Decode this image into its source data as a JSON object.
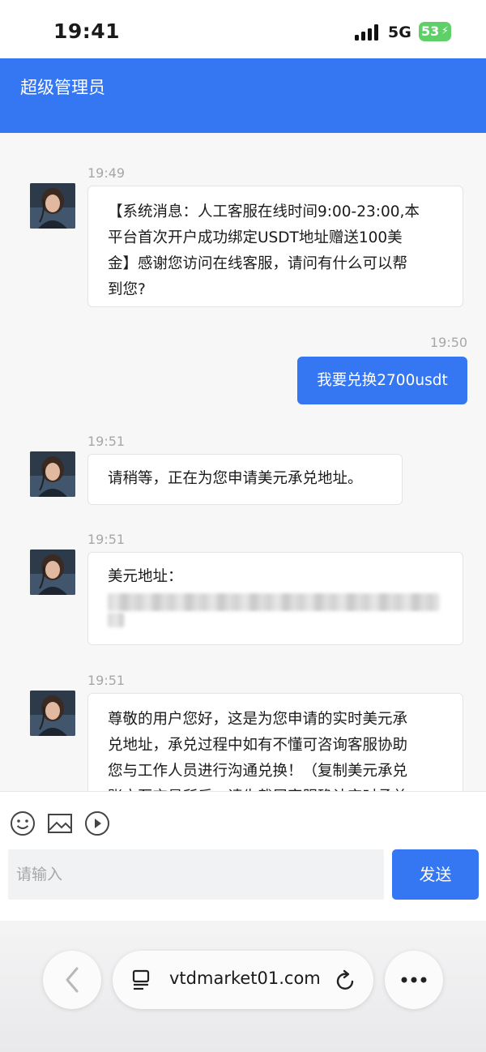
{
  "status_bar": {
    "time": "19:41",
    "network": "5G",
    "battery": "53"
  },
  "header": {
    "title": "超级管理员"
  },
  "messages": [
    {
      "time": "19:49",
      "text_lines": [
        "【系统消息：人工客服在线时间9:00-23:00,本",
        "平台首次开户成功绑定USDT地址赠送100美",
        "金】感谢您访问在线客服，请问有什么可以帮",
        "到您?"
      ]
    },
    {
      "time": "19:50",
      "text": "我要兑换2700usdt"
    },
    {
      "time": "19:51",
      "text": "请稍等，正在为您申请美元承兑地址。"
    },
    {
      "time": "19:51",
      "text": "美元地址："
    },
    {
      "time": "19:51",
      "text_lines": [
        "尊敬的用户您好，这是为您申请的实时美元承",
        "兑地址，承兑过程中如有不懂可咨询客服协助",
        "您与工作人员进行沟通兑换！（复制美元承兑",
        "账户至交易所后，请先截屏客服确认实时承兑"
      ]
    }
  ],
  "input": {
    "placeholder": "请输入",
    "send_label": "发送"
  },
  "toolbar": {
    "icons": [
      "emoji-icon",
      "image-icon",
      "play-icon"
    ]
  },
  "browser": {
    "url": "vtdmarket01.com",
    "icons": [
      "back-icon",
      "tabs-icon",
      "reload-icon",
      "more-icon"
    ]
  },
  "colors": {
    "accent": "#3577f2",
    "battery": "#5fd068"
  }
}
